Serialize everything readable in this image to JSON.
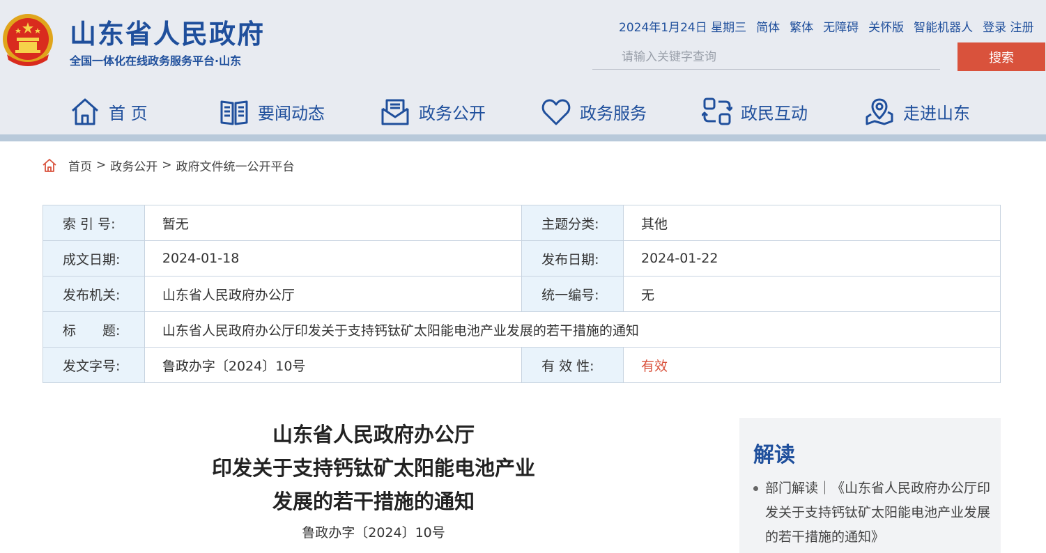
{
  "header": {
    "site_title": "山东省人民政府",
    "site_subtitle": "全国一体化在线政务服务平台·山东",
    "topbar": {
      "date": "2024年1月24日 星期三",
      "links": [
        "简体",
        "繁体",
        "无障碍",
        "关怀版",
        "智能机器人"
      ],
      "login": "登录",
      "register": "注册"
    },
    "search": {
      "placeholder": "请输入关键字查询",
      "button_label": "搜索"
    },
    "nav": [
      {
        "label": "首 页",
        "icon": "home-icon"
      },
      {
        "label": "要闻动态",
        "icon": "book-icon"
      },
      {
        "label": "政务公开",
        "icon": "envelope-icon"
      },
      {
        "label": "政务服务",
        "icon": "heart-icon"
      },
      {
        "label": "政民互动",
        "icon": "exchange-icon"
      },
      {
        "label": "走进山东",
        "icon": "map-pin-icon"
      }
    ]
  },
  "breadcrumb": {
    "icon": "home-icon",
    "items": [
      "首页",
      "政务公开",
      "政府文件统一公开平台"
    ],
    "separator": ">"
  },
  "info_table": {
    "index_label": "索 引 号:",
    "index_value": "暂无",
    "topic_label": "主题分类:",
    "topic_value": "其他",
    "written_label": "成文日期:",
    "written_value": "2024-01-18",
    "published_label": "发布日期:",
    "published_value": "2024-01-22",
    "issuer_label": "发布机关:",
    "issuer_value": "山东省人民政府办公厅",
    "serial_label": "统一编号:",
    "serial_value": "无",
    "title_label": "标　　题:",
    "title_value": "山东省人民政府办公厅印发关于支持钙钛矿太阳能电池产业发展的若干措施的通知",
    "docno_label": "发文字号:",
    "docno_value": "鲁政办字〔2024〕10号",
    "validity_label": "有 效 性:",
    "validity_value": "有效"
  },
  "document": {
    "title_line1": "山东省人民政府办公厅",
    "title_line2": "印发关于支持钙钛矿太阳能电池产业",
    "title_line3": "发展的若干措施的通知",
    "number": "鲁政办字〔2024〕10号"
  },
  "interpretation": {
    "heading": "解读",
    "item": "部门解读｜《山东省人民政府办公厅印发关于支持钙钛矿太阳能电池产业发展的若干措施的通知》"
  },
  "colors": {
    "brand_blue": "#1f4f9c",
    "accent_red": "#d9523c",
    "header_bg": "#e8ebf1",
    "table_label_bg": "#e9f3fb"
  }
}
